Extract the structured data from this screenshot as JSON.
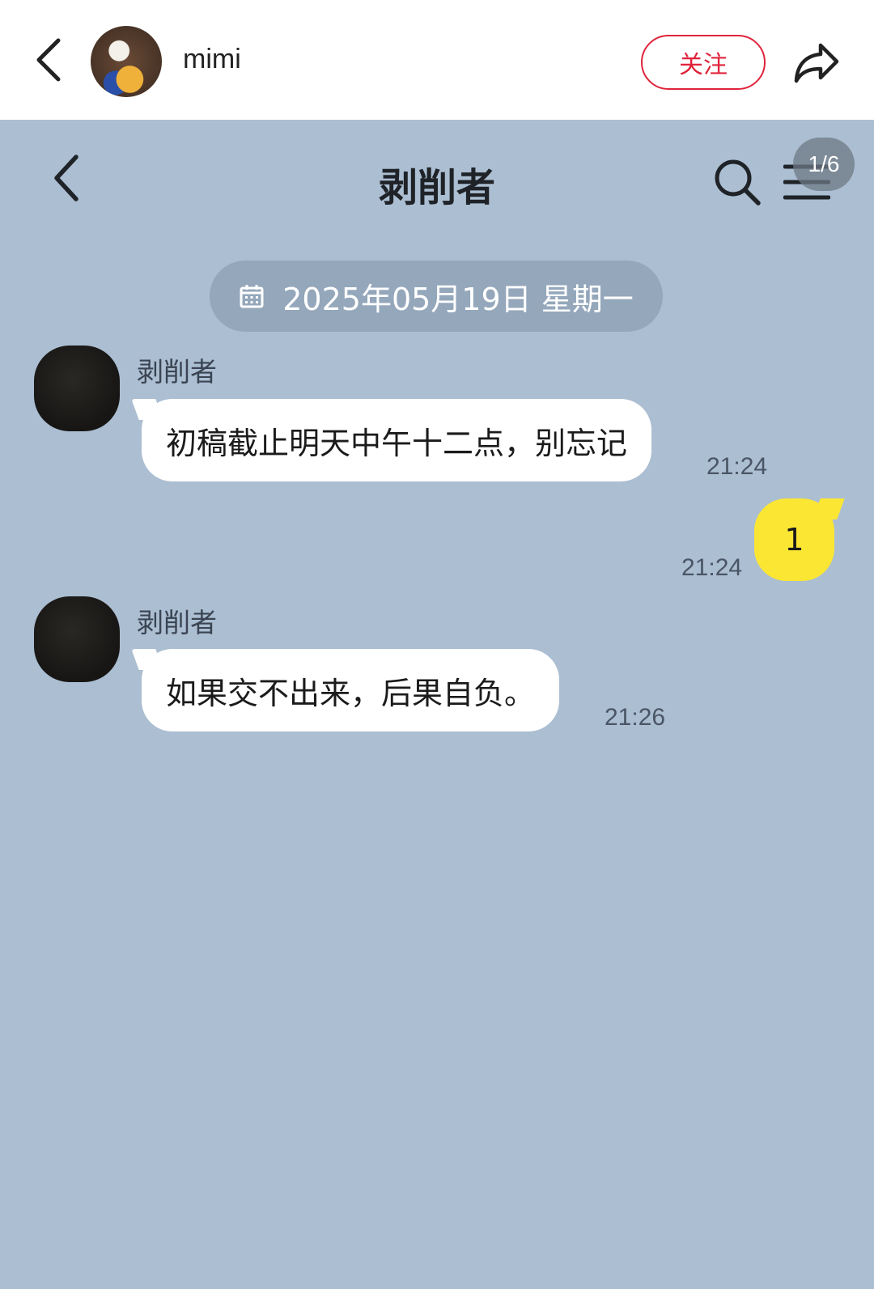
{
  "top_bar": {
    "username": "mimi",
    "follow_label": "关注"
  },
  "chat": {
    "title": "剥削者",
    "page_badge": "1/6",
    "date_label": "2025年05月19日 星期一"
  },
  "messages": [
    {
      "sender": "剥削者",
      "text": "初稿截止明天中午十二点，别忘记",
      "time": "21:24",
      "mine": false
    },
    {
      "text": "1",
      "time": "21:24",
      "mine": true
    },
    {
      "sender": "剥削者",
      "text": "如果交不出来，后果自负。",
      "time": "21:26",
      "mine": false
    }
  ],
  "colors": {
    "chat_background": "#abbed2",
    "my_bubble": "#fbe634",
    "follow_accent": "#e0243c"
  },
  "icons": [
    "back-arrow-icon",
    "share-icon",
    "search-icon",
    "menu-icon",
    "calendar-icon"
  ]
}
